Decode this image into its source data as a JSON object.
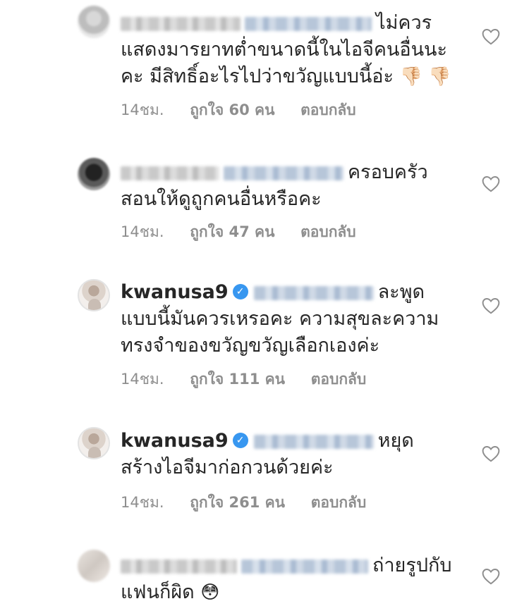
{
  "comments": [
    {
      "text": "ไม่ควรแสดงมารยาทต่ำขนาดนี้ในไอจีคนอื่นนะคะ มีสิทธิ์อะไรไปว่าขวัญแบบนี้อ่ะ",
      "emoji": "👎🏻 👎🏻",
      "time": "14ชม.",
      "likes": "ถูกใจ 60 คน",
      "reply": "ตอบกลับ"
    },
    {
      "text": "ครอบครัวสอนให้ดูถูกคนอื่นหรือคะ",
      "time": "14ชม.",
      "likes": "ถูกใจ 47 คน",
      "reply": "ตอบกลับ"
    },
    {
      "username": "kwanusa9",
      "text": "ละพูดแบบนี้มันควรเหรอคะ ความสุขละความทรงจำของขวัญขวัญเลือกเองค่ะ",
      "time": "14ชม.",
      "likes": "ถูกใจ 111 คน",
      "reply": "ตอบกลับ"
    },
    {
      "username": "kwanusa9",
      "text": "หยุดสร้างไอจีมาก่อกวนด้วยค่ะ",
      "time": "14ชม.",
      "likes": "ถูกใจ 261 คน",
      "reply": "ตอบกลับ"
    },
    {
      "text": "ถ่ายรูปกับแฟนก็ผิด",
      "emoji": "😳",
      "time": "",
      "likes": "",
      "reply": ""
    }
  ],
  "icons": {
    "like": "heart-outline-icon",
    "verified": "verified-badge-icon"
  },
  "colors": {
    "text": "#262626",
    "meta": "#8e8e8e",
    "verified": "#3897f0"
  }
}
